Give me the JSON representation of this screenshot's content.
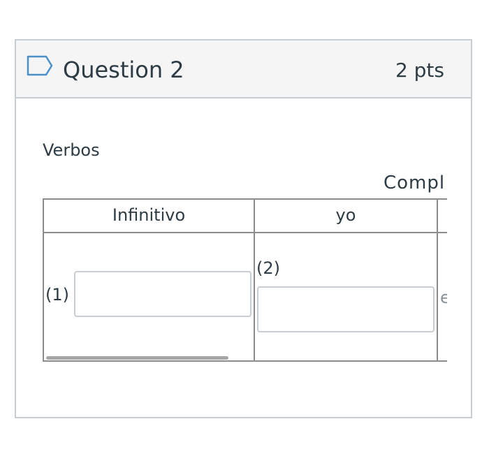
{
  "question": {
    "title": "Question 2",
    "points": "2 pts",
    "flag_icon": "flag-outline-icon"
  },
  "body": {
    "section_label": "Verbos",
    "table": {
      "caption": "Compl",
      "headers": [
        "Infinitivo",
        "yo"
      ],
      "row": {
        "cell1_number": "(1)",
        "cell2_number": "(2)",
        "cell3_partial_text": "e"
      },
      "inputs": [
        {
          "value": "",
          "placeholder": ""
        },
        {
          "value": "",
          "placeholder": ""
        }
      ]
    }
  },
  "colors": {
    "border": "#c7cdd1",
    "header_bg": "#f5f5f5",
    "grid": "#8c8c8c",
    "text": "#2d3b45",
    "scrollbar": "#a6a6a6"
  }
}
